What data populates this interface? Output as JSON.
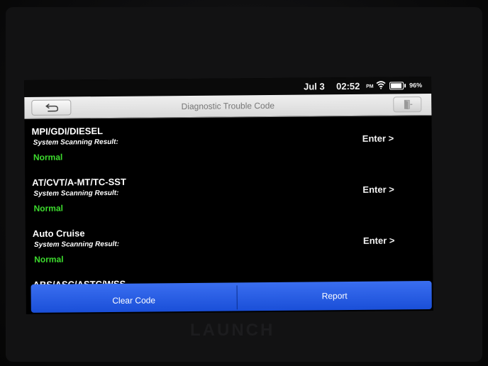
{
  "statusbar": {
    "date": "Jul 3",
    "time": "02:52",
    "ampm": "PM",
    "battery": "96%",
    "battery_level": 0.96
  },
  "titlebar": {
    "title": "Diagnostic Trouble Code",
    "back_icon": "back-arrow-icon",
    "exit_icon": "exit-door-icon"
  },
  "systems": [
    {
      "name": "MPI/GDI/DIESEL",
      "label": "System Scanning Result:",
      "status": "Normal",
      "action": "Enter >"
    },
    {
      "name": "AT/CVT/A-MT/TC-SST",
      "label": "System Scanning Result:",
      "status": "Normal",
      "action": "Enter >"
    },
    {
      "name": "Auto Cruise",
      "label": "System Scanning Result:",
      "status": "Normal",
      "action": "Enter >"
    },
    {
      "name": "ABS/ASC/ASTC/WSS",
      "label": "",
      "status": "",
      "action": ""
    }
  ],
  "actions": {
    "clear_code": "Clear Code",
    "report": "Report"
  },
  "brand": "LAUNCH",
  "colors": {
    "status_normal": "#3ddc2e",
    "action_bar": "#2a5ee6",
    "titlebar": "#e6e6e6"
  }
}
